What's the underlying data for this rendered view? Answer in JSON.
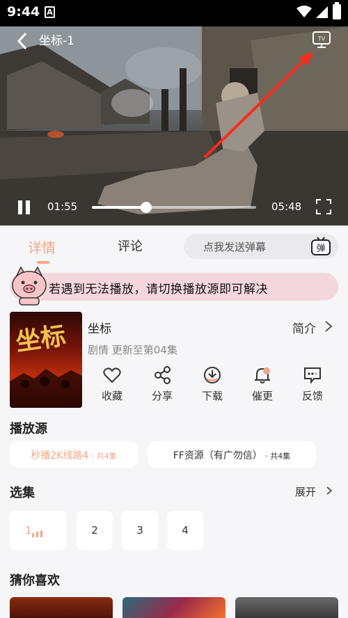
{
  "status_bar": {
    "time": "9:44",
    "notification_icon": "A"
  },
  "player": {
    "title": "坐标-1",
    "current_time": "01:55",
    "duration": "05:48",
    "progress": 0.33,
    "icons": [
      "back-icon",
      "tv-cast-icon",
      "pause-icon",
      "fullscreen-icon"
    ]
  },
  "tabs": [
    {
      "label": "详情",
      "active": true
    },
    {
      "label": "评论",
      "active": false
    }
  ],
  "danmaku": {
    "placeholder": "点我发送弹幕",
    "icon_text": "弹"
  },
  "notice": {
    "text": "若遇到无法播放，请切换播放源即可解决"
  },
  "show": {
    "title": "坐标",
    "intro_label": "简介",
    "meta": "剧情 更新至第04集",
    "poster_text": "坐标"
  },
  "actions": [
    {
      "label": "收藏",
      "icon": "heart-icon"
    },
    {
      "label": "分享",
      "icon": "share-icon"
    },
    {
      "label": "下载",
      "icon": "download-icon"
    },
    {
      "label": "催更",
      "icon": "bell-icon"
    },
    {
      "label": "反馈",
      "icon": "feedback-icon"
    }
  ],
  "sources": {
    "title": "播放源",
    "items": [
      {
        "name": "秒播2K线路4",
        "count": "· 共4集",
        "active": true
      },
      {
        "name": "FF资源（有广勿信）",
        "count": "· 共4集",
        "active": false
      }
    ]
  },
  "episodes": {
    "title": "选集",
    "expand_label": "展开",
    "items": [
      "1",
      "2",
      "3",
      "4"
    ],
    "active_index": 0
  },
  "recommend": {
    "title": "猜你喜欢"
  },
  "colors": {
    "accent": "#f3a58a",
    "notice_bg": "#f4d7dd",
    "sheet_bg": "#f6f6f8"
  }
}
